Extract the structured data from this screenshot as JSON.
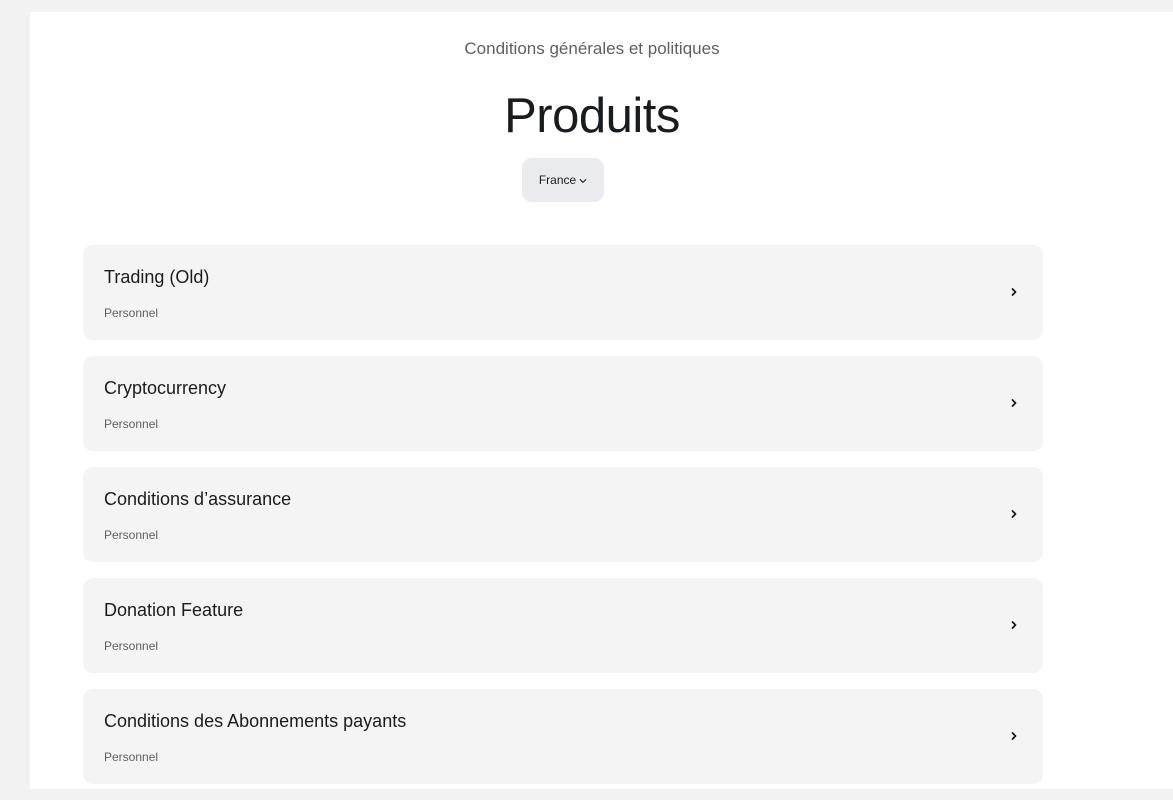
{
  "header": {
    "breadcrumb": "Conditions générales et politiques",
    "title": "Produits"
  },
  "country_select": {
    "value": "France",
    "icon": "chevron-down-icon"
  },
  "products": [
    {
      "title": "Trading (Old)",
      "subtitle": "Personnel",
      "icon": "chevron-right-icon"
    },
    {
      "title": "Cryptocurrency",
      "subtitle": "Personnel",
      "icon": "chevron-right-icon"
    },
    {
      "title": "Conditions d’assurance",
      "subtitle": "Personnel",
      "icon": "chevron-right-icon"
    },
    {
      "title": "Donation Feature",
      "subtitle": "Personnel",
      "icon": "chevron-right-icon"
    },
    {
      "title": "Conditions des Abonnements payants",
      "subtitle": "Personnel",
      "icon": "chevron-right-icon"
    }
  ],
  "colors": {
    "page_background": "#f2f2f2",
    "content_background": "#ffffff",
    "card_background": "#f4f4f4",
    "select_background": "#eaebee",
    "text_primary": "#191c1f",
    "text_secondary": "#5c5f63"
  }
}
